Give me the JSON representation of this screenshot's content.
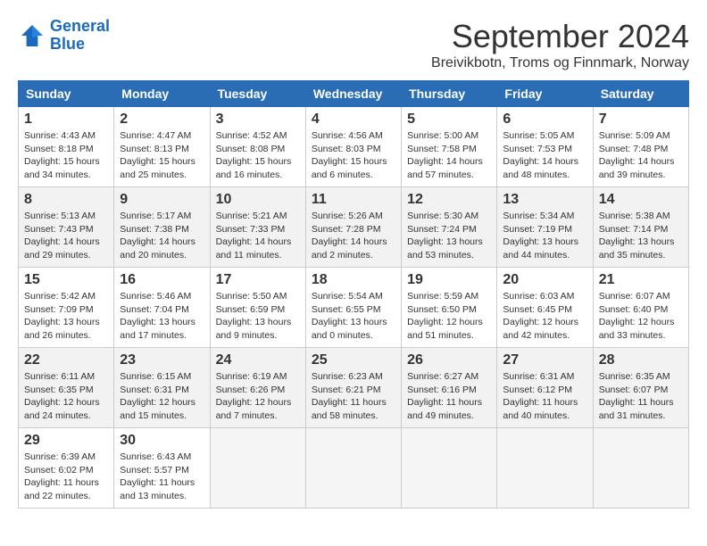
{
  "logo": {
    "line1": "General",
    "line2": "Blue"
  },
  "title": {
    "month_year": "September 2024",
    "location": "Breivikbotn, Troms og Finnmark, Norway"
  },
  "calendar": {
    "headers": [
      "Sunday",
      "Monday",
      "Tuesday",
      "Wednesday",
      "Thursday",
      "Friday",
      "Saturday"
    ],
    "weeks": [
      [
        {
          "num": "",
          "empty": true
        },
        {
          "num": "2",
          "sunrise": "Sunrise: 4:47 AM",
          "sunset": "Sunset: 8:13 PM",
          "daylight": "Daylight: 15 hours and 25 minutes."
        },
        {
          "num": "3",
          "sunrise": "Sunrise: 4:52 AM",
          "sunset": "Sunset: 8:08 PM",
          "daylight": "Daylight: 15 hours and 16 minutes."
        },
        {
          "num": "4",
          "sunrise": "Sunrise: 4:56 AM",
          "sunset": "Sunset: 8:03 PM",
          "daylight": "Daylight: 15 hours and 6 minutes."
        },
        {
          "num": "5",
          "sunrise": "Sunrise: 5:00 AM",
          "sunset": "Sunset: 7:58 PM",
          "daylight": "Daylight: 14 hours and 57 minutes."
        },
        {
          "num": "6",
          "sunrise": "Sunrise: 5:05 AM",
          "sunset": "Sunset: 7:53 PM",
          "daylight": "Daylight: 14 hours and 48 minutes."
        },
        {
          "num": "7",
          "sunrise": "Sunrise: 5:09 AM",
          "sunset": "Sunset: 7:48 PM",
          "daylight": "Daylight: 14 hours and 39 minutes."
        }
      ],
      [
        {
          "num": "1",
          "sunrise": "Sunrise: 4:43 AM",
          "sunset": "Sunset: 8:18 PM",
          "daylight": "Daylight: 15 hours and 34 minutes."
        },
        {
          "num": "8",
          "sunrise": "Sunrise: 5:13 AM",
          "sunset": "Sunset: 7:43 PM",
          "daylight": "Daylight: 14 hours and 29 minutes."
        },
        {
          "num": "9",
          "sunrise": "Sunrise: 5:17 AM",
          "sunset": "Sunset: 7:38 PM",
          "daylight": "Daylight: 14 hours and 20 minutes."
        },
        {
          "num": "10",
          "sunrise": "Sunrise: 5:21 AM",
          "sunset": "Sunset: 7:33 PM",
          "daylight": "Daylight: 14 hours and 11 minutes."
        },
        {
          "num": "11",
          "sunrise": "Sunrise: 5:26 AM",
          "sunset": "Sunset: 7:28 PM",
          "daylight": "Daylight: 14 hours and 2 minutes."
        },
        {
          "num": "12",
          "sunrise": "Sunrise: 5:30 AM",
          "sunset": "Sunset: 7:24 PM",
          "daylight": "Daylight: 13 hours and 53 minutes."
        },
        {
          "num": "13",
          "sunrise": "Sunrise: 5:34 AM",
          "sunset": "Sunset: 7:19 PM",
          "daylight": "Daylight: 13 hours and 44 minutes."
        },
        {
          "num": "14",
          "sunrise": "Sunrise: 5:38 AM",
          "sunset": "Sunset: 7:14 PM",
          "daylight": "Daylight: 13 hours and 35 minutes."
        }
      ],
      [
        {
          "num": "15",
          "sunrise": "Sunrise: 5:42 AM",
          "sunset": "Sunset: 7:09 PM",
          "daylight": "Daylight: 13 hours and 26 minutes."
        },
        {
          "num": "16",
          "sunrise": "Sunrise: 5:46 AM",
          "sunset": "Sunset: 7:04 PM",
          "daylight": "Daylight: 13 hours and 17 minutes."
        },
        {
          "num": "17",
          "sunrise": "Sunrise: 5:50 AM",
          "sunset": "Sunset: 6:59 PM",
          "daylight": "Daylight: 13 hours and 9 minutes."
        },
        {
          "num": "18",
          "sunrise": "Sunrise: 5:54 AM",
          "sunset": "Sunset: 6:55 PM",
          "daylight": "Daylight: 13 hours and 0 minutes."
        },
        {
          "num": "19",
          "sunrise": "Sunrise: 5:59 AM",
          "sunset": "Sunset: 6:50 PM",
          "daylight": "Daylight: 12 hours and 51 minutes."
        },
        {
          "num": "20",
          "sunrise": "Sunrise: 6:03 AM",
          "sunset": "Sunset: 6:45 PM",
          "daylight": "Daylight: 12 hours and 42 minutes."
        },
        {
          "num": "21",
          "sunrise": "Sunrise: 6:07 AM",
          "sunset": "Sunset: 6:40 PM",
          "daylight": "Daylight: 12 hours and 33 minutes."
        }
      ],
      [
        {
          "num": "22",
          "sunrise": "Sunrise: 6:11 AM",
          "sunset": "Sunset: 6:35 PM",
          "daylight": "Daylight: 12 hours and 24 minutes."
        },
        {
          "num": "23",
          "sunrise": "Sunrise: 6:15 AM",
          "sunset": "Sunset: 6:31 PM",
          "daylight": "Daylight: 12 hours and 15 minutes."
        },
        {
          "num": "24",
          "sunrise": "Sunrise: 6:19 AM",
          "sunset": "Sunset: 6:26 PM",
          "daylight": "Daylight: 12 hours and 7 minutes."
        },
        {
          "num": "25",
          "sunrise": "Sunrise: 6:23 AM",
          "sunset": "Sunset: 6:21 PM",
          "daylight": "Daylight: 11 hours and 58 minutes."
        },
        {
          "num": "26",
          "sunrise": "Sunrise: 6:27 AM",
          "sunset": "Sunset: 6:16 PM",
          "daylight": "Daylight: 11 hours and 49 minutes."
        },
        {
          "num": "27",
          "sunrise": "Sunrise: 6:31 AM",
          "sunset": "Sunset: 6:12 PM",
          "daylight": "Daylight: 11 hours and 40 minutes."
        },
        {
          "num": "28",
          "sunrise": "Sunrise: 6:35 AM",
          "sunset": "Sunset: 6:07 PM",
          "daylight": "Daylight: 11 hours and 31 minutes."
        }
      ],
      [
        {
          "num": "29",
          "sunrise": "Sunrise: 6:39 AM",
          "sunset": "Sunset: 6:02 PM",
          "daylight": "Daylight: 11 hours and 22 minutes."
        },
        {
          "num": "30",
          "sunrise": "Sunrise: 6:43 AM",
          "sunset": "Sunset: 5:57 PM",
          "daylight": "Daylight: 11 hours and 13 minutes."
        },
        {
          "num": "",
          "empty": true
        },
        {
          "num": "",
          "empty": true
        },
        {
          "num": "",
          "empty": true
        },
        {
          "num": "",
          "empty": true
        },
        {
          "num": "",
          "empty": true
        }
      ]
    ]
  }
}
